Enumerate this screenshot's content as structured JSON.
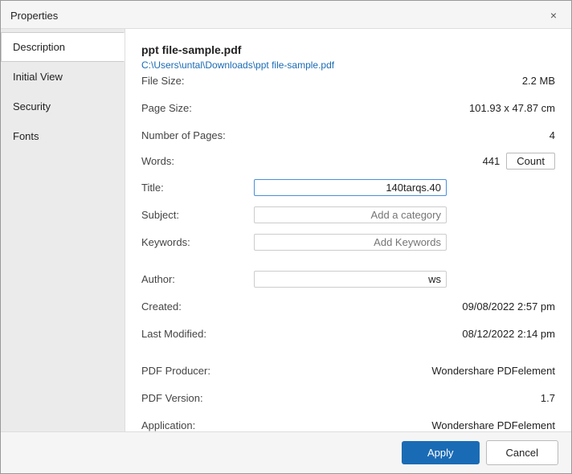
{
  "dialog": {
    "title": "Properties",
    "close_icon": "×"
  },
  "sidebar": {
    "items": [
      {
        "id": "description",
        "label": "Description",
        "active": true
      },
      {
        "id": "initial-view",
        "label": "Initial View",
        "active": false
      },
      {
        "id": "security",
        "label": "Security",
        "active": false
      },
      {
        "id": "fonts",
        "label": "Fonts",
        "active": false
      }
    ]
  },
  "content": {
    "file_name": "ppt file-sample.pdf",
    "file_path": "C:\\Users\\untal\\Downloads\\ppt file-sample.pdf",
    "properties": [
      {
        "label": "File Size:",
        "value": "2.2 MB"
      },
      {
        "label": "Page Size:",
        "value": "101.93 x 47.87 cm"
      },
      {
        "label": "Number of Pages:",
        "value": "4"
      }
    ],
    "words_label": "Words:",
    "words_value": "441",
    "count_button": "Count",
    "title_label": "Title:",
    "title_value": "140tarqs.40",
    "subject_label": "Subject:",
    "subject_placeholder": "Add a category",
    "keywords_label": "Keywords:",
    "keywords_placeholder": "Add Keywords",
    "author_label": "Author:",
    "author_value": "ws",
    "created_label": "Created:",
    "created_value": "09/08/2022 2:57 pm",
    "last_modified_label": "Last Modified:",
    "last_modified_value": "08/12/2022 2:14 pm",
    "pdf_producer_label": "PDF Producer:",
    "pdf_producer_value": "Wondershare PDFelement",
    "pdf_version_label": "PDF Version:",
    "pdf_version_value": "1.7",
    "application_label": "Application:",
    "application_value": "Wondershare PDFelement"
  },
  "footer": {
    "apply_label": "Apply",
    "cancel_label": "Cancel"
  }
}
